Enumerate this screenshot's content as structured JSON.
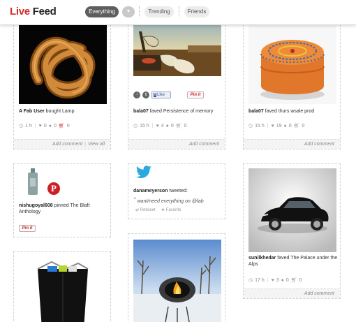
{
  "header": {
    "logo_live": "Live",
    "logo_feed": "Feed",
    "tabs": [
      {
        "label": "Everything",
        "active": true
      },
      {
        "label": "Trending",
        "active": false
      },
      {
        "label": "Friends",
        "active": false
      }
    ],
    "caret_glyph": "▼"
  },
  "colors": {
    "brand_red": "#d42a2a",
    "pinterest_red": "#cb2027",
    "twitter_blue": "#2aa9e0"
  },
  "cards": {
    "lamp": {
      "user": "A Fab User",
      "action": "bought Lamp",
      "time": "1 h",
      "likes": "0",
      "comments": "0",
      "carts": "0",
      "add_comment": "Add comment",
      "view_all": "View all"
    },
    "memory": {
      "user": "bala07",
      "action": "faved Persistence of memory",
      "time": "15 h",
      "likes": "4",
      "comments": "0",
      "carts": "0",
      "fb_like": "Like",
      "pinit": "Pin it",
      "add_comment": "Add comment"
    },
    "pouf": {
      "user": "bala07",
      "action": "faved thurs wsale prod",
      "time": "15 h",
      "likes": "19",
      "comments": "0",
      "carts": "0",
      "add_comment": "Add comment"
    },
    "pinned": {
      "user": "nishugoyal608",
      "action": "pinned The Blaft Anthology",
      "pinit": "Pin it"
    },
    "tweet": {
      "user": "danameyerson",
      "action": "tweeted:",
      "quote": "want/need everything on @fab",
      "retweet": "Retweet",
      "favorite": "Favorite"
    },
    "car": {
      "user": "sunilkhedar",
      "action": "faved The Palace under the Alps",
      "time": "17 h",
      "likes": "3",
      "comments": "0",
      "carts": "0",
      "add_comment": "Add comment"
    }
  },
  "icons": [
    "clock-icon",
    "heart-icon",
    "comment-icon",
    "cart-icon",
    "pinterest-icon",
    "twitter-bird-icon",
    "tumblr-icon",
    "retweet-icon",
    "star-icon"
  ]
}
